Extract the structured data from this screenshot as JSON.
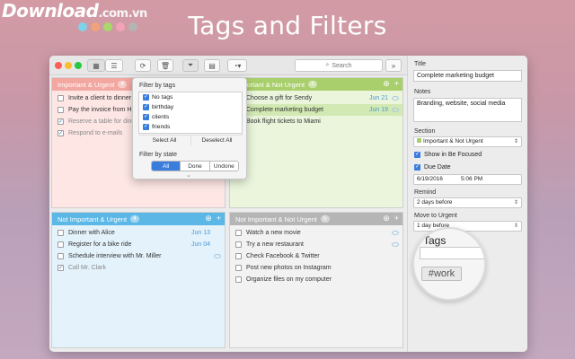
{
  "watermark": {
    "brand": "Download",
    "domain": ".com.vn",
    "dot_colors": [
      "#7fd3e8",
      "#f0a37a",
      "#a8d86a",
      "#f3a3b8",
      "#b4b4b4"
    ]
  },
  "headline": "Tags and Filters",
  "toolbar": {
    "search_placeholder": "Search",
    "more_label": "»"
  },
  "quadrants": {
    "q1": {
      "title": "Important & Urgent",
      "count": "4",
      "color": "#f2a7a1",
      "bg": "#fde6e4",
      "tasks": [
        {
          "label": "Invite a client to dinner",
          "done": false
        },
        {
          "label": "Pay the invoice from H",
          "done": false
        },
        {
          "label": "Reserve a table for dinner",
          "done": true
        },
        {
          "label": "Respond to e-mails",
          "done": true
        }
      ]
    },
    "q2": {
      "title": "Important & Not Urgent",
      "count": "3",
      "color": "#a9cf6c",
      "bg": "#eaf5dc",
      "tasks": [
        {
          "label": "Choose a gift for Sendy",
          "due": "Jun 21",
          "done": false
        },
        {
          "label": "Complete marketing budget",
          "due": "Jun 19",
          "done": false,
          "selected": true
        },
        {
          "label": "Book flight tickets to Miami",
          "done": false
        }
      ]
    },
    "q3": {
      "title": "Not Important & Urgent",
      "count": "4",
      "color": "#5ab7e6",
      "bg": "#e3f2fb",
      "tasks": [
        {
          "label": "Dinner with Alice",
          "due": "Jun 13",
          "done": false
        },
        {
          "label": "Register for a bike ride",
          "due": "Jun 04",
          "done": false
        },
        {
          "label": "Schedule interview with Mr. Miller",
          "done": false
        },
        {
          "label": "Call Mr. Clark",
          "done": true
        }
      ]
    },
    "q4": {
      "title": "Not Important & Not Urgent",
      "count": "5",
      "color": "#b5b5b5",
      "bg": "#f2f2f2",
      "tasks": [
        {
          "label": "Watch a new movie",
          "done": false
        },
        {
          "label": "Try a new restaurant",
          "done": false
        },
        {
          "label": "Check Facebook & Twitter",
          "done": false
        },
        {
          "label": "Post new photos on Instagram",
          "done": false
        },
        {
          "label": "Organize files on my computer",
          "done": false
        }
      ]
    }
  },
  "filter_popover": {
    "tags_title": "Filter by tags",
    "tags": [
      "No tags",
      "birthday",
      "clients",
      "friends"
    ],
    "select_all": "Select All",
    "deselect_all": "Deselect All",
    "state_title": "Filter by state",
    "states": [
      "All",
      "Done",
      "Undone"
    ]
  },
  "details": {
    "title_label": "Title",
    "title_value": "Complete marketing budget",
    "notes_label": "Notes",
    "notes_value": "Branding, website, social media",
    "section_label": "Section",
    "section_value": "Important & Not Urgent",
    "show_in_focus": "Show in Be Focused",
    "due_date_label": "Due Date",
    "date_value": "6/19/2016",
    "time_value": "5:06 PM",
    "remind_label": "Remind",
    "remind_value": "2 days before",
    "move_label": "Move to Urgent",
    "move_value": "1 day before",
    "tags_label": "Tags",
    "tag_chip": "#work"
  }
}
